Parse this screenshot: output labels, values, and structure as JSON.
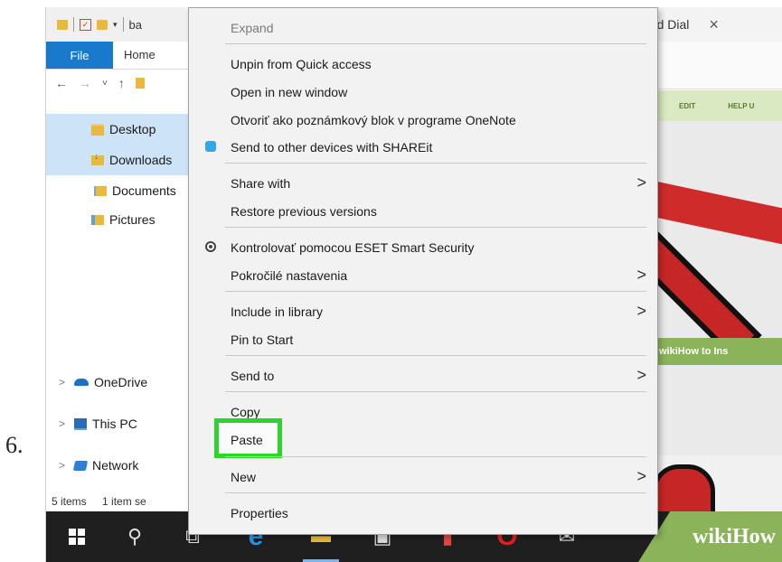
{
  "step": "6.",
  "explorer": {
    "window_title": "ba",
    "tabs": [
      "File",
      "Home"
    ],
    "nav_items": [
      "Desktop",
      "Downloads",
      "Documents",
      "Pictures"
    ],
    "tree_items": [
      "OneDrive",
      "This PC",
      "Network"
    ],
    "status_items": "5 items",
    "status_selected": "1 item se"
  },
  "browser": {
    "tab_title": "eed Dial",
    "close": "×",
    "menu_edit": "EDIT",
    "menu_help": "HELP U",
    "banner": "wikiHow to Ins",
    "corner_logo": "wikiHow"
  },
  "context_menu": {
    "expand": "Expand",
    "unpin": "Unpin from Quick access",
    "open_new_window": "Open in new window",
    "onenote": "Otvoriť ako poznámkový blok v programe OneNote",
    "shareit": "Send to other devices with SHAREit",
    "share_with": "Share with",
    "restore": "Restore previous versions",
    "eset": "Kontrolovať pomocou ESET Smart Security",
    "advanced": "Pokročilé nastavenia",
    "include_library": "Include in library",
    "pin_start": "Pin to Start",
    "send_to": "Send to",
    "copy": "Copy",
    "paste": "Paste",
    "new": "New",
    "properties": "Properties",
    "highlight_color": "#2cd42c"
  },
  "icons": {
    "submenu_arrow": "chevron-right-icon",
    "shareit": "shareit-icon",
    "eset": "eset-icon"
  }
}
